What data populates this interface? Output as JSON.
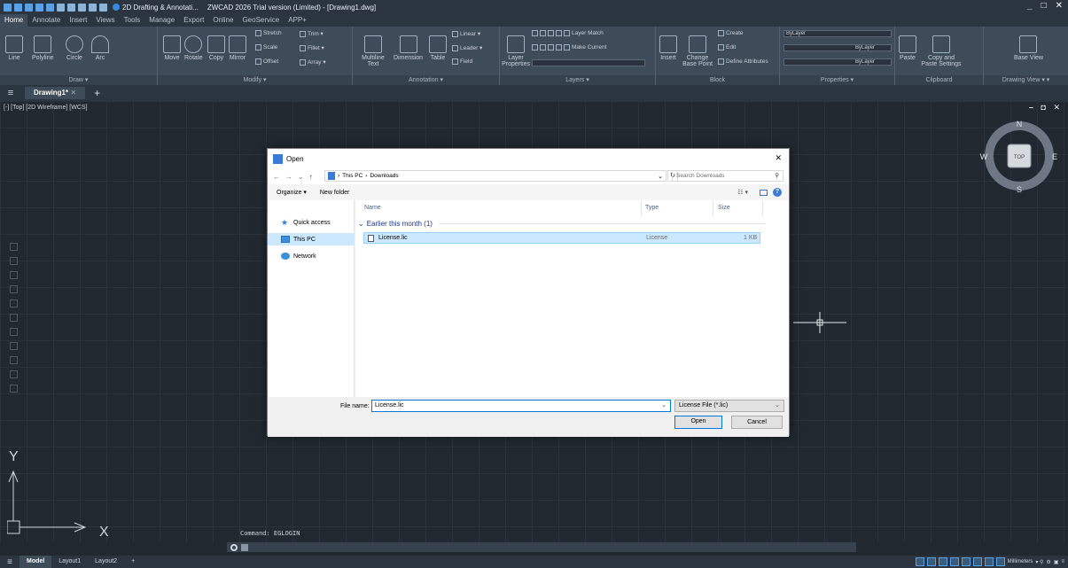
{
  "titlebar": {
    "workspace": "2D Drafting & Annotati...",
    "title": "ZWCAD 2026 Trial version (Limited) - [Drawing1.dwg]",
    "minimize": "_",
    "maximize": "□",
    "close": "✕"
  },
  "menu_tabs": [
    "Home",
    "Annotate",
    "Insert",
    "Views",
    "Tools",
    "Manage",
    "Export",
    "Online",
    "GeoService",
    "APP+"
  ],
  "ribbon": {
    "draw": {
      "name": "Draw ▾",
      "tools": [
        "Line",
        "Polyline",
        "Circle",
        "Arc"
      ]
    },
    "modify": {
      "name": "Modify ▾",
      "tools": [
        "Move",
        "Rotate",
        "Copy",
        "Mirror"
      ],
      "small": [
        "Stretch",
        "Trim ▾",
        "Scale",
        "Fillet ▾",
        "Offset",
        "Array ▾"
      ]
    },
    "annotation": {
      "name": "Annotation ▾",
      "tools": [
        "Multiline Text",
        "Dimension",
        "Table"
      ],
      "small": [
        "Linear ▾",
        "Leader ▾",
        "Field"
      ]
    },
    "layers": {
      "name": "Layers ▾",
      "tools": [
        "Layer Properties"
      ],
      "small": [
        "Layer Match",
        "Make Current"
      ]
    },
    "block": {
      "name": "Block",
      "tools": [
        "Insert",
        "Change Base Point"
      ],
      "small": [
        "Create",
        "Edit",
        "Define Attributes"
      ]
    },
    "properties": {
      "name": "Properties ▾",
      "values": [
        "ByLayer",
        "ByLayer",
        "ByLayer"
      ]
    },
    "clipboard": {
      "name": "Clipboard",
      "tools": [
        "Paste",
        "Copy and Paste Settings"
      ]
    },
    "drawing_view": {
      "name": "Drawing View ▾ ▾",
      "tools": [
        "Base View"
      ]
    }
  },
  "doc_tabs": {
    "active": "Drawing1*",
    "close": "✕",
    "new": "+"
  },
  "viewport": {
    "label": "[-] [Top] [2D Wireframe] [WCS]",
    "controls": "– ◘ ✕"
  },
  "viewcube": {
    "top": "TOP",
    "n": "N",
    "s": "S",
    "e": "E",
    "w": "W"
  },
  "ucs": {
    "x": "X",
    "y": "Y"
  },
  "command": {
    "text": "Command: EGLOGIN"
  },
  "layout_tabs": [
    "Model",
    "Layout1",
    "Layout2"
  ],
  "status": {
    "units": "Millimeters"
  },
  "dialog": {
    "title": "Open",
    "close": "✕",
    "breadcrumb": [
      "This PC",
      "Downloads"
    ],
    "search_placeholder": "Search Downloads",
    "organize": "Organize ▾",
    "new_folder": "New folder",
    "nav": [
      {
        "label": "Quick access",
        "icon": "star-icon"
      },
      {
        "label": "This PC",
        "icon": "computer-icon",
        "selected": true
      },
      {
        "label": "Network",
        "icon": "network-icon"
      }
    ],
    "columns": {
      "name": "Name",
      "type": "Type",
      "size": "Size"
    },
    "group": "Earlier this month (1)",
    "file": {
      "name": "License.lic",
      "type": "License",
      "size": "1 KB"
    },
    "file_name_label": "File name:",
    "file_name_value": "License.lic",
    "file_type": "License File (*.lic)",
    "open_button": "Open",
    "cancel_button": "Cancel"
  }
}
